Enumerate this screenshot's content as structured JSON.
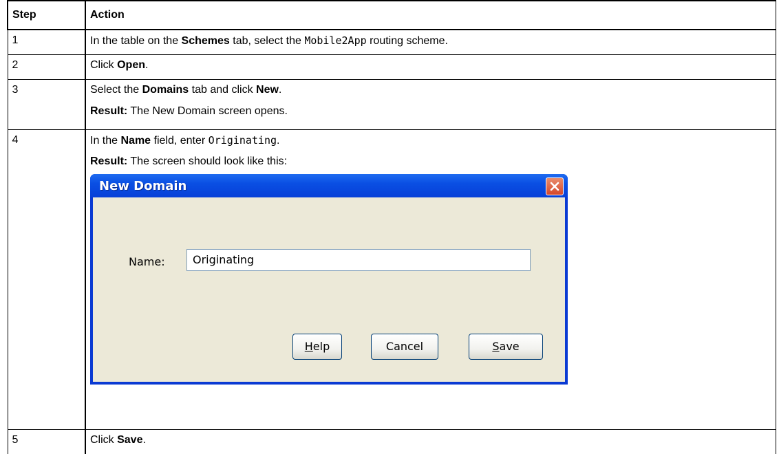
{
  "table": {
    "headers": {
      "step": "Step",
      "action": "Action"
    },
    "rows": [
      {
        "step": "1",
        "t1": "In the table on the ",
        "b1": "Schemes",
        "t2": " tab, select the ",
        "code1": "Mobile2App",
        "t3": " routing scheme."
      },
      {
        "step": "2",
        "t1": "Click ",
        "b1": "Open",
        "t2": "."
      },
      {
        "step": "3",
        "t1": "Select the ",
        "b1": "Domains",
        "t2": " tab and click ",
        "b2": "New",
        "t3": ".",
        "result_label": "Result:",
        "result_text": " The New Domain screen opens."
      },
      {
        "step": "4",
        "t1": "In the ",
        "b1": "Name",
        "t2": " field, enter ",
        "code1": "Originating",
        "t3": ".",
        "result_label": "Result:",
        "result_text": " The screen should look like this:"
      },
      {
        "step": "5",
        "t1": "Click ",
        "b1": "Save",
        "t2": "."
      }
    ]
  },
  "dialog": {
    "title": "New Domain",
    "name_label": "Name:",
    "name_value": "Originating",
    "buttons": {
      "help_mnemonic": "H",
      "help_rest": "elp",
      "cancel": "Cancel",
      "save_mnemonic": "S",
      "save_rest": "ave"
    }
  }
}
